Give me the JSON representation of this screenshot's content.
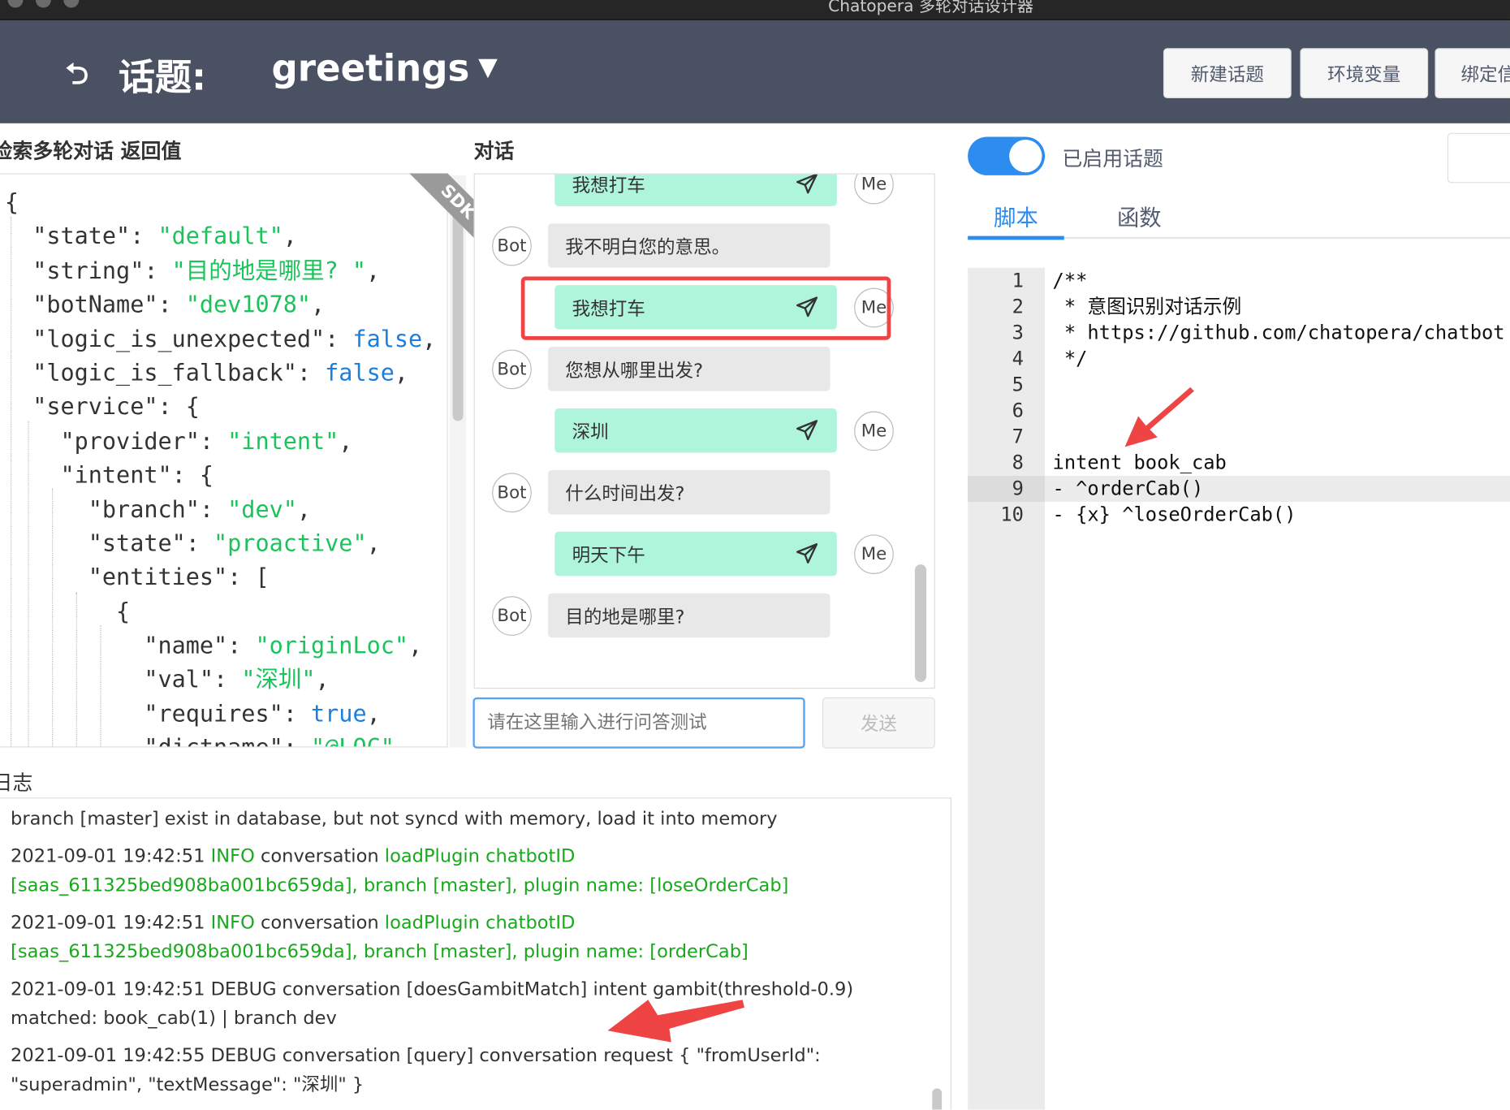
{
  "window": {
    "title": "Chatopera 多轮对话设计器"
  },
  "header": {
    "back_icon": "return-arrow-icon",
    "topic_label": "话题:",
    "topic_name": "greetings",
    "buttons": [
      "新建话题",
      "环境变量",
      "绑定信"
    ]
  },
  "result_panel": {
    "title": "检索多轮对话 返回值",
    "ribbon": "SDK",
    "lines": [
      [
        {
          "t": "{"
        }
      ],
      [
        {
          "t": "  \"state\": "
        },
        {
          "t": "\"default\"",
          "c": "s"
        },
        {
          "t": ","
        }
      ],
      [
        {
          "t": "  \"string\": "
        },
        {
          "t": "\"目的地是哪里? \"",
          "c": "s"
        },
        {
          "t": ","
        }
      ],
      [
        {
          "t": "  \"botName\": "
        },
        {
          "t": "\"dev1078\"",
          "c": "s"
        },
        {
          "t": ","
        }
      ],
      [
        {
          "t": "  \"logic_is_unexpected\": "
        },
        {
          "t": "false",
          "c": "b"
        },
        {
          "t": ","
        }
      ],
      [
        {
          "t": "  \"logic_is_fallback\": "
        },
        {
          "t": "false",
          "c": "b"
        },
        {
          "t": ","
        }
      ],
      [
        {
          "t": "  \"service\": {"
        }
      ],
      [
        {
          "t": "    \"provider\": "
        },
        {
          "t": "\"intent\"",
          "c": "s"
        },
        {
          "t": ","
        }
      ],
      [
        {
          "t": "    \"intent\": {"
        }
      ],
      [
        {
          "t": "      \"branch\": "
        },
        {
          "t": "\"dev\"",
          "c": "s"
        },
        {
          "t": ","
        }
      ],
      [
        {
          "t": "      \"state\": "
        },
        {
          "t": "\"proactive\"",
          "c": "s"
        },
        {
          "t": ","
        }
      ],
      [
        {
          "t": "      \"entities\": ["
        }
      ],
      [
        {
          "t": "        {"
        }
      ],
      [
        {
          "t": "          \"name\": "
        },
        {
          "t": "\"originLoc\"",
          "c": "s"
        },
        {
          "t": ","
        }
      ],
      [
        {
          "t": "          \"val\": "
        },
        {
          "t": "\"深圳\"",
          "c": "s"
        },
        {
          "t": ","
        }
      ],
      [
        {
          "t": "          \"requires\": "
        },
        {
          "t": "true",
          "c": "b"
        },
        {
          "t": ","
        }
      ],
      [
        {
          "t": "          \"dictname\": "
        },
        {
          "t": "\"@LOC\"",
          "c": "s"
        }
      ]
    ]
  },
  "chat": {
    "title": "对话",
    "me_label": "Me",
    "bot_label": "Bot",
    "messages": [
      {
        "from": "me",
        "text": "我想打车"
      },
      {
        "from": "bot",
        "text": "我不明白您的意思。"
      },
      {
        "from": "me",
        "text": "我想打车",
        "highlighted": true
      },
      {
        "from": "bot",
        "text": "您想从哪里出发?"
      },
      {
        "from": "me",
        "text": "深圳"
      },
      {
        "from": "bot",
        "text": "什么时间出发?"
      },
      {
        "from": "me",
        "text": "明天下午"
      },
      {
        "from": "bot",
        "text": "目的地是哪里?"
      }
    ],
    "input_placeholder": "请在这里输入进行问答测试",
    "send_label": "发送"
  },
  "logs": {
    "title": "日志",
    "entries": [
      [
        {
          "t": "branch [master] exist in database, but not syncd with memory, load it into memory"
        }
      ],
      [
        {
          "t": "2021-09-01 19:42:51   "
        },
        {
          "t": "INFO",
          "c": "g"
        },
        {
          "t": "   conversation  "
        },
        {
          "t": "loadPlugin chatbotID [saas_611325bed908ba001bc659da], branch [master], plugin name: [loseOrderCab]",
          "c": "g"
        }
      ],
      [
        {
          "t": "2021-09-01 19:42:51   "
        },
        {
          "t": "INFO",
          "c": "g"
        },
        {
          "t": "   conversation  "
        },
        {
          "t": "loadPlugin chatbotID [saas_611325bed908ba001bc659da], branch [master], plugin name: [orderCab]",
          "c": "g"
        }
      ],
      [
        {
          "t": "2021-09-01 19:42:51   DEBUG   conversation  [doesGambitMatch] intent gambit(threshold-0.9) matched: book_cab(1) | branch dev"
        }
      ],
      [
        {
          "t": "2021-09-01 19:42:55   DEBUG   conversation  [query] conversation request { \"fromUserId\": \"superadmin\", \"textMessage\": \"深圳\" }"
        }
      ]
    ]
  },
  "right": {
    "toggle_on": true,
    "toggle_label": "已启用话题",
    "tabs": [
      {
        "label": "脚本",
        "active": true
      },
      {
        "label": "函数",
        "active": false
      }
    ],
    "code_lines": [
      "/**",
      " * 意图识别对话示例",
      " * https://github.com/chatopera/chatbot",
      " */",
      "",
      "",
      "",
      "intent book_cab",
      "- ^orderCab()",
      "- {x} ^loseOrderCab()"
    ],
    "active_line": 9
  },
  "colors": {
    "header_bg": "#4a5162",
    "accent": "#2d8cf0",
    "me_bubble": "#aef5dc",
    "bot_bubble": "#e8e8e8",
    "highlight_box": "#ef4444",
    "string": "#1bc35b",
    "boolean": "#1a7fe0",
    "log_green": "#19a81d"
  }
}
